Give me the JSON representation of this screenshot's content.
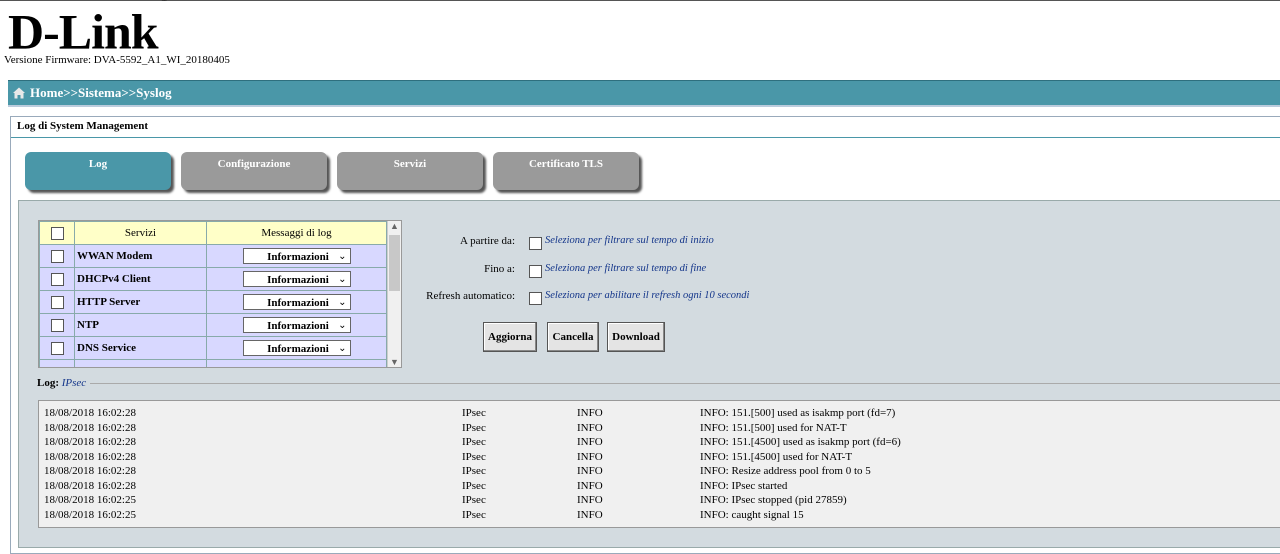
{
  "header": {
    "logo_text": "D-Link",
    "logo_mark": "®",
    "firmware": "Versione Firmware: DVA-5592_A1_WI_20180405"
  },
  "nav": {
    "breadcrumb": "Home>>Sistema>>Syslog",
    "accent_color": "#4a97a8"
  },
  "section": {
    "title": "Log di System Management"
  },
  "tabs": [
    {
      "label": "Log",
      "active": true
    },
    {
      "label": "Configurazione",
      "active": false
    },
    {
      "label": "Servizi",
      "active": false
    },
    {
      "label": "Certificato TLS",
      "active": false
    }
  ],
  "services_table": {
    "headers": [
      "Servizi",
      "Messaggi di log"
    ],
    "rows": [
      {
        "name": "WWAN Modem",
        "level": "Informazioni"
      },
      {
        "name": "DHCPv4 Client",
        "level": "Informazioni"
      },
      {
        "name": "HTTP Server",
        "level": "Informazioni"
      },
      {
        "name": "NTP",
        "level": "Informazioni"
      },
      {
        "name": "DNS Service",
        "level": "Informazioni"
      }
    ]
  },
  "filters": {
    "from": {
      "label": "A partire da:",
      "hint": "Seleziona per filtrare sul tempo di inizio"
    },
    "to": {
      "label": "Fino a:",
      "hint": "Seleziona per filtrare sul tempo di fine"
    },
    "refresh": {
      "label": "Refresh automatico:",
      "hint": "Seleziona per abilitare il refresh ogni 10 secondi"
    }
  },
  "buttons": {
    "update": "Aggiorna",
    "cancel": "Cancella",
    "download": "Download"
  },
  "log": {
    "label": "Log:",
    "service": "IPsec",
    "entries": [
      {
        "time": "18/08/2018 16:02:28",
        "service": "IPsec",
        "level": "INFO",
        "message": "INFO: 151.[500] used as isakmp port (fd=7)"
      },
      {
        "time": "18/08/2018 16:02:28",
        "service": "IPsec",
        "level": "INFO",
        "message": "INFO: 151.[500] used for NAT-T"
      },
      {
        "time": "18/08/2018 16:02:28",
        "service": "IPsec",
        "level": "INFO",
        "message": "INFO: 151.[4500] used as isakmp port (fd=6)"
      },
      {
        "time": "18/08/2018 16:02:28",
        "service": "IPsec",
        "level": "INFO",
        "message": "INFO: 151.[4500] used for NAT-T"
      },
      {
        "time": "18/08/2018 16:02:28",
        "service": "IPsec",
        "level": "INFO",
        "message": "INFO: Resize address pool from 0 to 5"
      },
      {
        "time": "18/08/2018 16:02:28",
        "service": "IPsec",
        "level": "INFO",
        "message": "INFO: IPsec started"
      },
      {
        "time": "18/08/2018 16:02:25",
        "service": "IPsec",
        "level": "INFO",
        "message": "INFO: IPsec stopped (pid 27859)"
      },
      {
        "time": "18/08/2018 16:02:25",
        "service": "IPsec",
        "level": "INFO",
        "message": "INFO: caught signal 15"
      }
    ]
  }
}
